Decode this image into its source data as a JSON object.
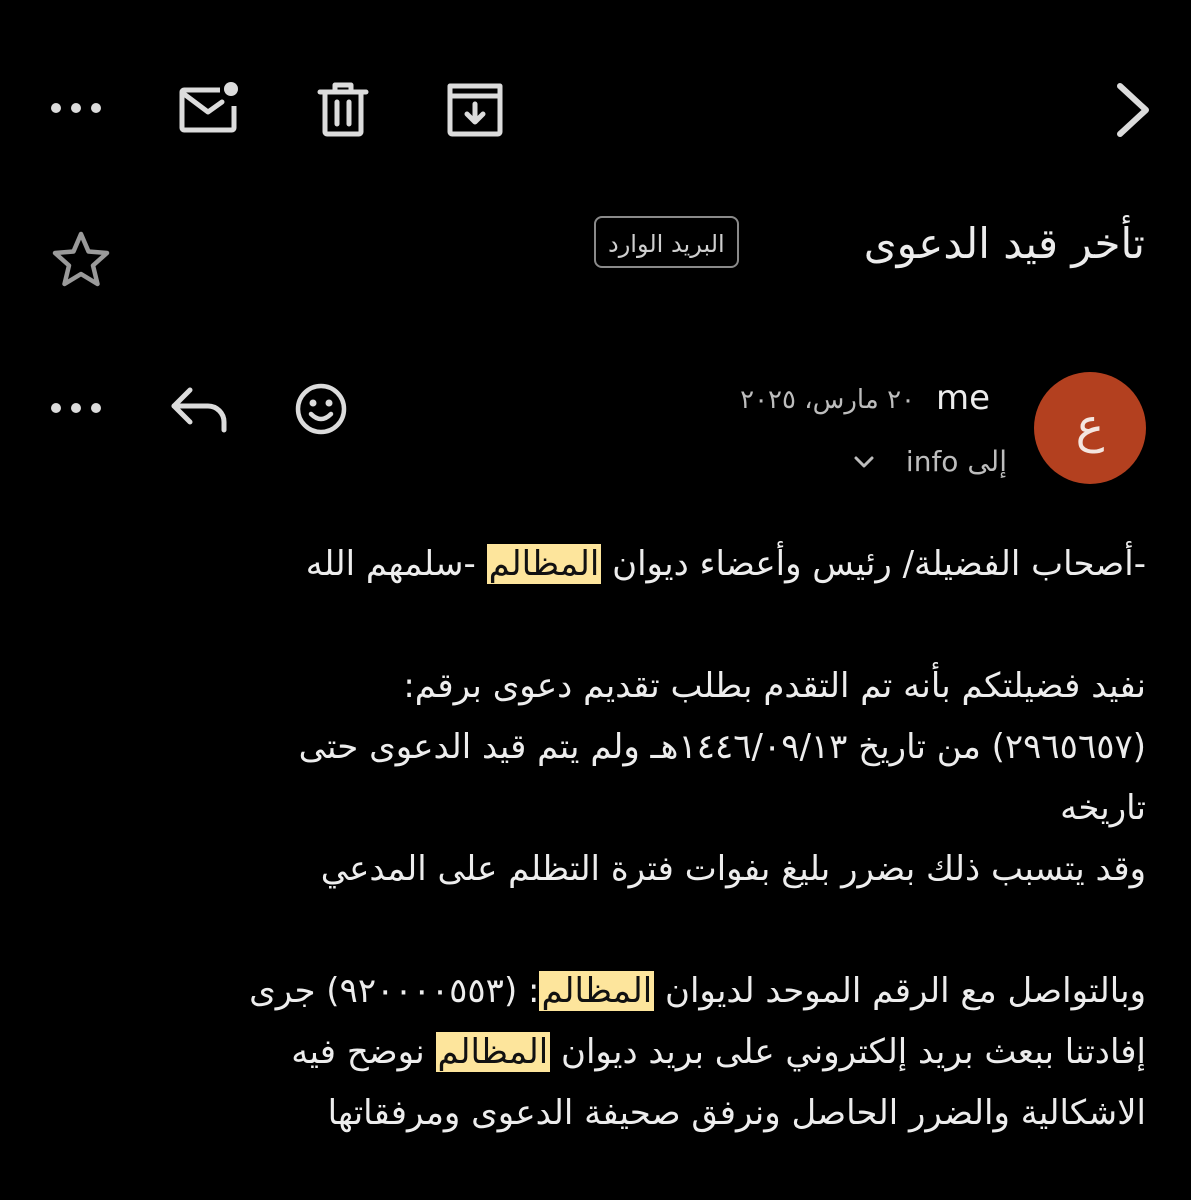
{
  "toolbar": {
    "icons": [
      "more-horizontal-icon",
      "mark-unread-icon",
      "trash-icon",
      "archive-icon",
      "chevron-right-icon"
    ]
  },
  "subject": {
    "title": "تأخر قيد الدعوى",
    "label": "البريد الوارد"
  },
  "message": {
    "avatar_letter": "ع",
    "avatar_color": "#b3401f",
    "sender": "me",
    "date": "٢٠ مارس، ٢٠٢٥",
    "to_prefix": "إلى",
    "to": "info"
  },
  "body": {
    "highlight_color": "#fde59c",
    "greeting": {
      "before": "-أصحاب الفضيلة/ رئيس وأعضاء ديوان ",
      "hl": "المظالم",
      "after": " -سلمهم الله"
    },
    "para1": {
      "line1": "نفيد فضيلتكم بأنه تم التقدم بطلب تقديم دعوى برقم:",
      "line2": "(٢٩٦٥٦٥٧) من تاريخ ١٤٤٦/٠٩/١٣هـ ولم يتم قيد الدعوى حتى",
      "line3": "تاريخه",
      "line4": "وقد يتسبب ذلك بضرر بليغ بفوات فترة التظلم على المدعي"
    },
    "para2": {
      "line1_before": "وبالتواصل مع الرقم الموحد لديوان ",
      "line1_hl": "المظالم",
      "line1_after": ": (٩٢٠٠٠٠٥٥٣) جرى",
      "line2_before": "إفادتنا ببعث بريد إلكتروني على بريد ديوان ",
      "line2_hl": "المظالم",
      "line2_after": " نوضح فيه",
      "line3": "الاشكالية والضرر الحاصل ونرفق صحيفة الدعوى ومرفقاتها"
    }
  }
}
